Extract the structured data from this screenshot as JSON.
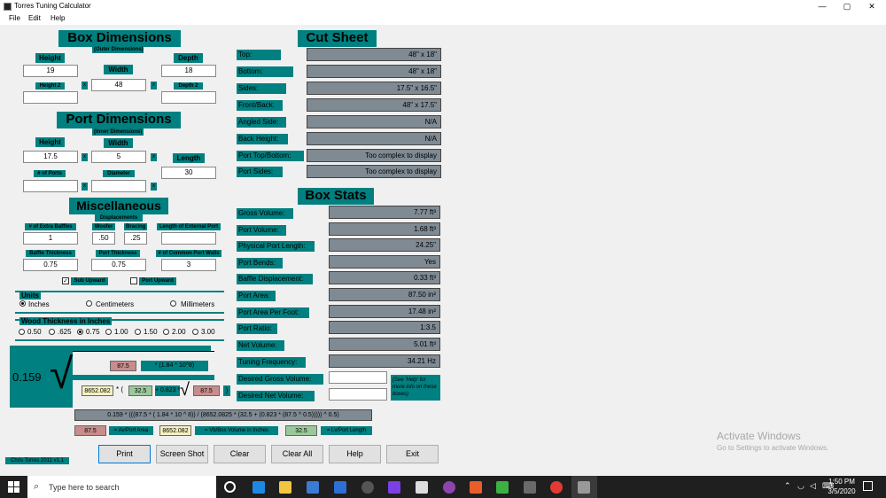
{
  "window": {
    "title": "Torres Tuning Calculator",
    "min": "—",
    "max": "▢",
    "close": "✕"
  },
  "menu": [
    "File",
    "Edit",
    "Help"
  ],
  "box": {
    "title": "Box Dimensions",
    "subtitle": "(Outer Dimensions)",
    "height_label": "Height",
    "height": "19",
    "width_label": "Width",
    "width": "48",
    "depth_label": "Depth",
    "depth": "18",
    "height2_label": "Height 2",
    "height2": "",
    "depth2_label": "Depth 2",
    "depth2": ""
  },
  "port": {
    "title": "Port Dimensions",
    "subtitle": "(Inner Dimensions)",
    "height_label": "Height",
    "height": "17.5",
    "width_label": "Width",
    "width": "5",
    "length_label": "Length",
    "length": "30",
    "ports_label": "# of Ports",
    "ports": "",
    "diameter_label": "Diameter",
    "diameter": ""
  },
  "misc": {
    "title": "Miscellaneous",
    "displacements": "Displacements",
    "extra_baffles_label": "# of Extra Baffles",
    "extra_baffles": "1",
    "woofer_label": "Woofer",
    "woofer": ".50",
    "bracing_label": "Bracing",
    "bracing": ".25",
    "ext_port_label": "Length of External Port",
    "ext_port": "",
    "baffle_thick_label": "Baffle Thickness",
    "baffle_thick": "0.75",
    "port_thick_label": "Port Thickness",
    "port_thick": "0.75",
    "common_walls_label": "# of Common Port Walls",
    "common_walls": "3",
    "sub_upward": "Sub Upward",
    "sub_upward_checked": "✓",
    "port_upward": "Port Upward"
  },
  "units": {
    "title": "Units",
    "options": [
      "Inches",
      "Centimeters",
      "Millimeters"
    ],
    "selected": 0
  },
  "wood": {
    "title": "Wood Thickness in Inches",
    "options": [
      "0.50",
      ".625",
      "0.75",
      "1.00",
      "1.50",
      "2.00",
      "3.00"
    ],
    "selected": 2
  },
  "formula": {
    "coef": "0.159",
    "a": "87.5",
    "b": "* (1.84 * 10^8)",
    "c": "8652.082",
    "d": "* (",
    "e": "32.5",
    "f": "+ 0.823 *",
    "g": "87.5",
    "h": ")",
    "full": "0.159 * (((87.5 * ( 1.84 * 10 ^ 8)) / (8652.0825 * (32.5 + (0.823 * (87.5 ^ 0.5))))) ^ 0.5)",
    "leg1_val": "87.5",
    "leg1": "= Av/Port Area",
    "leg2_val": "8652.082",
    "leg2": "= Vb/Box Volume in Inches",
    "leg3_val": "32.5",
    "leg3": "= Lv/Port Length"
  },
  "cut": {
    "title": "Cut Sheet",
    "rows": [
      {
        "label": "Top:",
        "value": "48\" x 18\""
      },
      {
        "label": "Bottom:",
        "value": "48\" x 18\""
      },
      {
        "label": "Sides:",
        "value": "17.5\" x 16.5\""
      },
      {
        "label": "Front/Back:",
        "value": "48\" x 17.5\""
      },
      {
        "label": "Angled Side:",
        "value": "N/A"
      },
      {
        "label": "Back Height:",
        "value": "N/A"
      },
      {
        "label": "Port Top/Bottom:",
        "value": "Too complex to display"
      },
      {
        "label": "Port Sides:",
        "value": "Too complex to display"
      }
    ]
  },
  "stats": {
    "title": "Box Stats",
    "rows": [
      {
        "label": "Gross Volume:",
        "value": "7.77 ft³"
      },
      {
        "label": "Port Volume:",
        "value": "1.68 ft³"
      },
      {
        "label": "Physical Port Length:",
        "value": "24.25\""
      },
      {
        "label": "Port Bends:",
        "value": "Yes"
      },
      {
        "label": "Baffle Displacement:",
        "value": "0.33 ft³"
      },
      {
        "label": "Port Area:",
        "value": "87.50 in²"
      },
      {
        "label": "Port Area Per Foot:",
        "value": "17.48 in²"
      },
      {
        "label": "Port Ratio:",
        "value": "1:3.5"
      },
      {
        "label": "Net Volume:",
        "value": "5.01 ft³"
      },
      {
        "label": "Tuning Frequency:",
        "value": "34.21 Hz"
      }
    ],
    "desired_gross": "Desired Gross Volume:",
    "desired_net": "Desired Net Volume:",
    "help_note": "(See 'Help' for more info on these boxes)"
  },
  "buttons": [
    "Print",
    "Screen Shot",
    "Clear",
    "Clear All",
    "Help",
    "Exit"
  ],
  "credit": "Chris Torres 2011 v1.1",
  "watermark": {
    "title": "Activate Windows",
    "sub": "Go to Settings to activate Windows."
  },
  "taskbar": {
    "search": "Type here to search",
    "time": "1:50 PM",
    "date": "3/5/2020"
  }
}
